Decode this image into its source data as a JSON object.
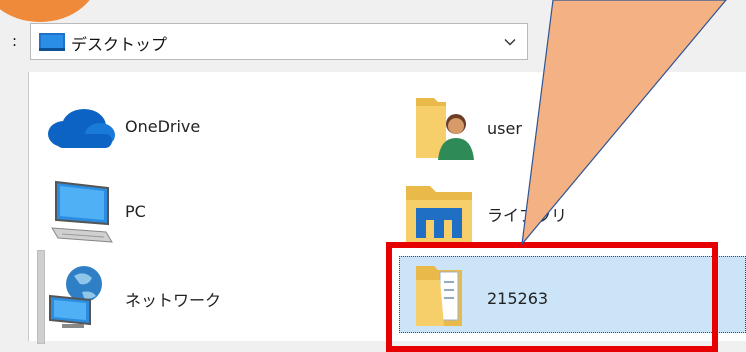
{
  "window": {
    "lookin_colon": ":",
    "lookin_value": "デスクトップ"
  },
  "items": [
    {
      "label": "OneDrive",
      "icon": "onedrive-cloud-icon"
    },
    {
      "label": "PC",
      "icon": "pc-monitor-icon"
    },
    {
      "label": "ネットワーク",
      "icon": "network-globe-icon"
    },
    {
      "label": "user",
      "icon": "user-folder-icon"
    },
    {
      "label": "ライブラリ",
      "icon": "library-folder-icon"
    },
    {
      "label": "215263",
      "icon": "document-folder-icon",
      "selected": true
    }
  ],
  "colors": {
    "selection": "#cce4f7",
    "highlight_frame": "#e60000",
    "callout_fill": "#f4b183",
    "callout_stroke": "#2f5597",
    "accent_orange": "#ef8a3a"
  }
}
